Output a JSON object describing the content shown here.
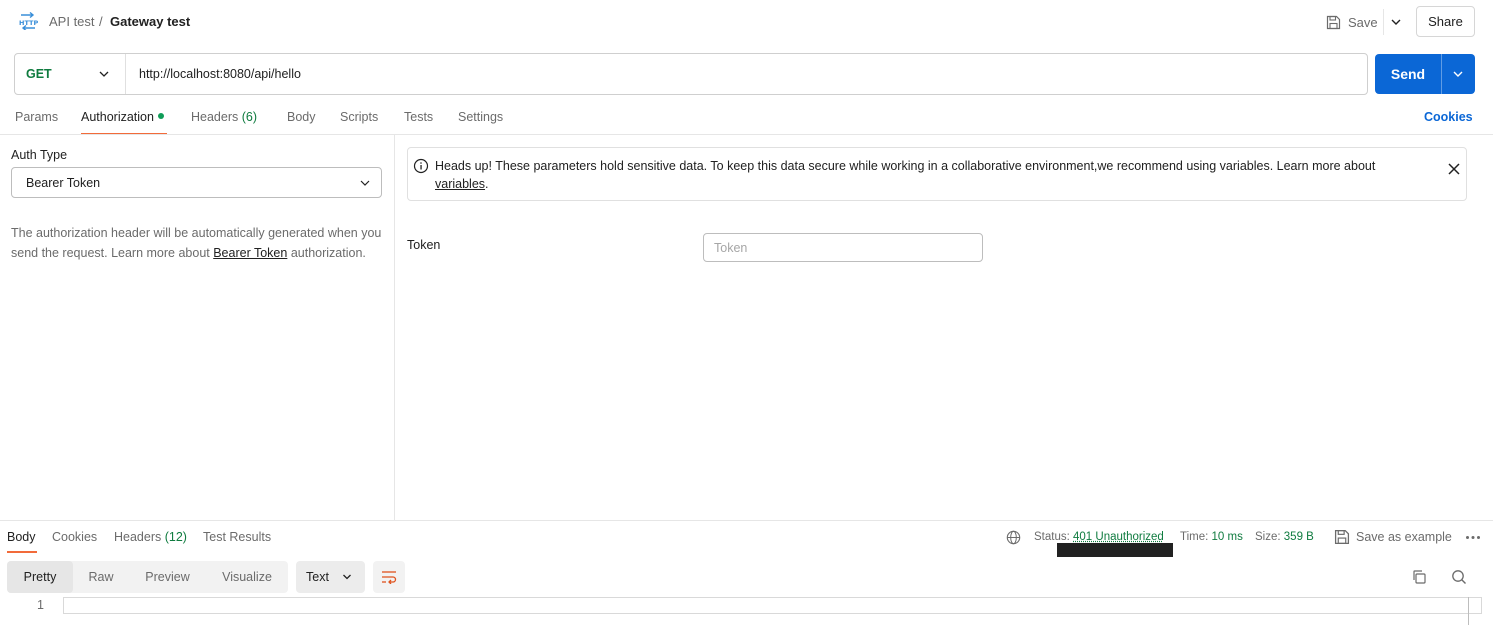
{
  "header": {
    "icon": "http-icon",
    "breadcrumb_parent": "API test",
    "breadcrumb_separator": "/",
    "request_name": "Gateway test",
    "save_label": "Save",
    "share_label": "Share"
  },
  "request": {
    "method": "GET",
    "url": "http://localhost:8080/api/hello",
    "send_label": "Send",
    "method_color": "#0f7b3f"
  },
  "request_tabs": {
    "params": "Params",
    "authorization": "Authorization",
    "headers": "Headers",
    "headers_count": "(6)",
    "body": "Body",
    "scripts": "Scripts",
    "tests": "Tests",
    "settings": "Settings",
    "cookies": "Cookies"
  },
  "auth": {
    "type_label": "Auth Type",
    "type_value": "Bearer Token",
    "desc_before": "The authorization header will be automatically generated when you send the request. Learn more about ",
    "desc_link": "Bearer Token",
    "desc_after": " authorization."
  },
  "banner": {
    "text": "Heads up! These parameters hold sensitive data. To keep this data secure while working in a collaborative environment,we recommend using variables. Learn more about ",
    "link": "variables",
    "after": "."
  },
  "token": {
    "label": "Token",
    "placeholder": "Token",
    "value": ""
  },
  "response": {
    "tabs": {
      "body": "Body",
      "cookies": "Cookies",
      "headers": "Headers",
      "headers_count": "(12)",
      "test_results": "Test Results"
    },
    "status_label": "Status:",
    "status_value": "401 Unauthorized",
    "time_label": "Time:",
    "time_value": "10 ms",
    "size_label": "Size:",
    "size_value": "359 B",
    "save_example": "Save as example",
    "format_tabs": [
      "Pretty",
      "Raw",
      "Preview",
      "Visualize"
    ],
    "format_selected": "Text",
    "line_number": "1",
    "body_text": ""
  },
  "colors": {
    "accent": "#0b67d6",
    "success": "#0f7b3f",
    "active_tab_underline": "#f26b3a"
  }
}
